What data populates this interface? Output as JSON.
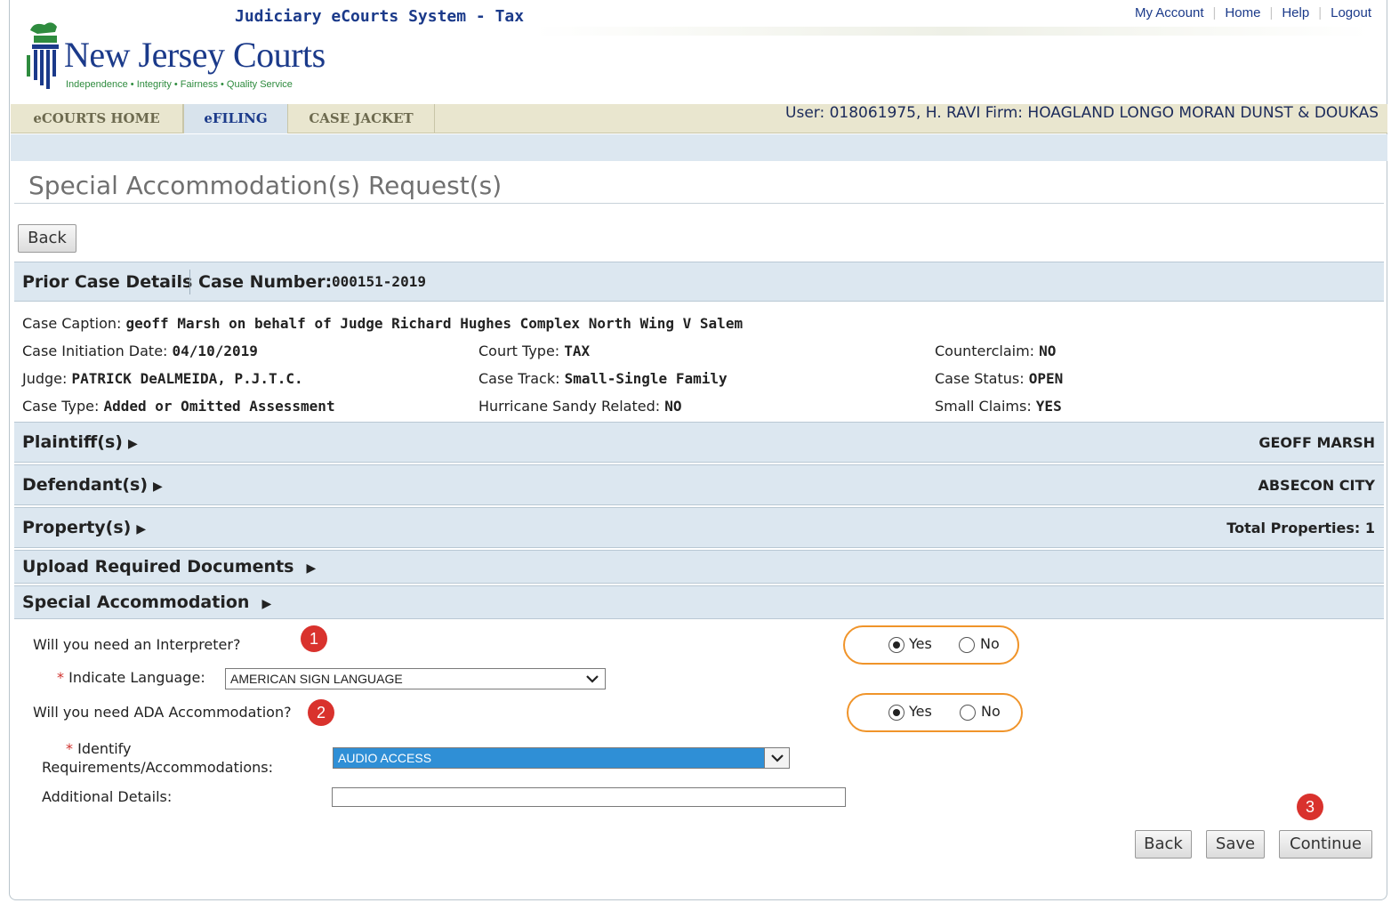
{
  "header": {
    "system_title": "Judiciary eCourts System - Tax",
    "links": [
      "My Account",
      "Home",
      "Help",
      "Logout"
    ],
    "logo_name": "New Jersey Courts",
    "logo_tagline": "Independence • Integrity • Fairness • Quality Service"
  },
  "nav": {
    "tabs": [
      "eCOURTS HOME",
      "eFILING",
      "CASE JACKET"
    ],
    "active_tab": "eFILING"
  },
  "user_info": "User: 018061975, H. RAVI  Firm: HOAGLAND LONGO MORAN DUNST & DOUKAS",
  "page_title": "Special Accommodation(s) Request(s)",
  "back_top": "Back",
  "prior_case": {
    "label": "Prior Case Details",
    "case_number_label": "Case Number:",
    "case_number": "000151-2019"
  },
  "details": {
    "caption_label": "Case Caption:",
    "caption": "geoff Marsh on behalf of Judge Richard Hughes Complex North Wing V Salem",
    "initiation_label": "Case Initiation Date:",
    "initiation": "04/10/2019",
    "court_type_label": "Court Type:",
    "court_type": "TAX",
    "counterclaim_label": "Counterclaim:",
    "counterclaim": "NO",
    "judge_label": "Judge:",
    "judge": "PATRICK DeALMEIDA, P.J.T.C.",
    "track_label": "Case Track:",
    "track": "Small-Single Family",
    "status_label": "Case Status:",
    "status": "OPEN",
    "type_label": "Case Type:",
    "type": "Added or Omitted Assessment",
    "hurricane_label": "Hurricane Sandy Related:",
    "hurricane": "NO",
    "small_claims_label": "Small Claims:",
    "small_claims": "YES"
  },
  "sections": {
    "plaintiff": "Plaintiff(s)",
    "plaintiff_value": "GEOFF MARSH",
    "defendant": "Defendant(s)",
    "defendant_value": "ABSECON CITY",
    "property": "Property(s)",
    "property_value": "Total Properties: 1",
    "upload": "Upload Required Documents",
    "special": "Special Accommodation"
  },
  "form": {
    "interpreter_q": "Will you need an Interpreter?",
    "badge1": "1",
    "yes": "Yes",
    "no": "No",
    "language_label": "Indicate Language:",
    "language_value": "AMERICAN SIGN LANGUAGE",
    "ada_q": "Will you need ADA Accommodation?",
    "badge2": "2",
    "identify_label_1": "Identify",
    "identify_label_2": "Requirements/Accommodations:",
    "identify_value": "AUDIO ACCESS",
    "additional_label": "Additional Details:",
    "additional_value": "",
    "badge3": "3"
  },
  "buttons": {
    "back": "Back",
    "save": "Save",
    "continue": "Continue"
  },
  "colors": {
    "accent_oval": "#f0942a",
    "badge": "#d9322d",
    "section_bg": "#dce7f0",
    "nav_bg": "#e9e6cf"
  }
}
